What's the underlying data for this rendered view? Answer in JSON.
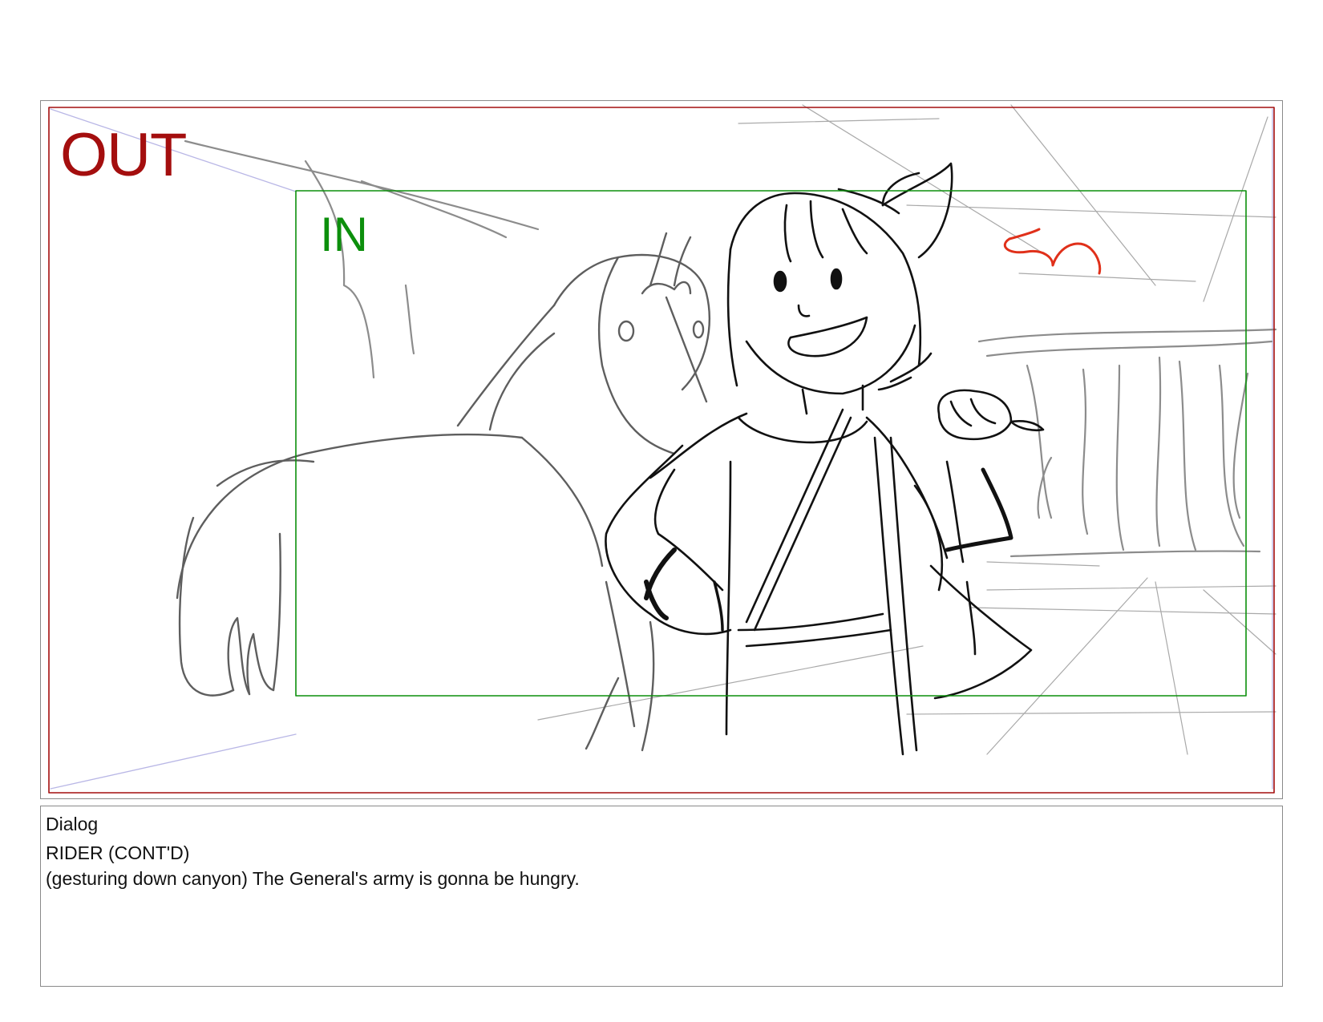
{
  "panel": {
    "out_label": "OUT",
    "in_label": "IN",
    "colors": {
      "out_frame": "#a40e0e",
      "in_frame": "#0c8f0c",
      "camera_arrow": "#e0301a",
      "perspective_line": "#b9b7e6"
    },
    "icons": [
      "camera-move-arrow-icon"
    ]
  },
  "dialog": {
    "title": "Dialog",
    "speaker": "RIDER (CONT'D)",
    "line": "(gesturing down canyon) The General's army is gonna be hungry."
  }
}
